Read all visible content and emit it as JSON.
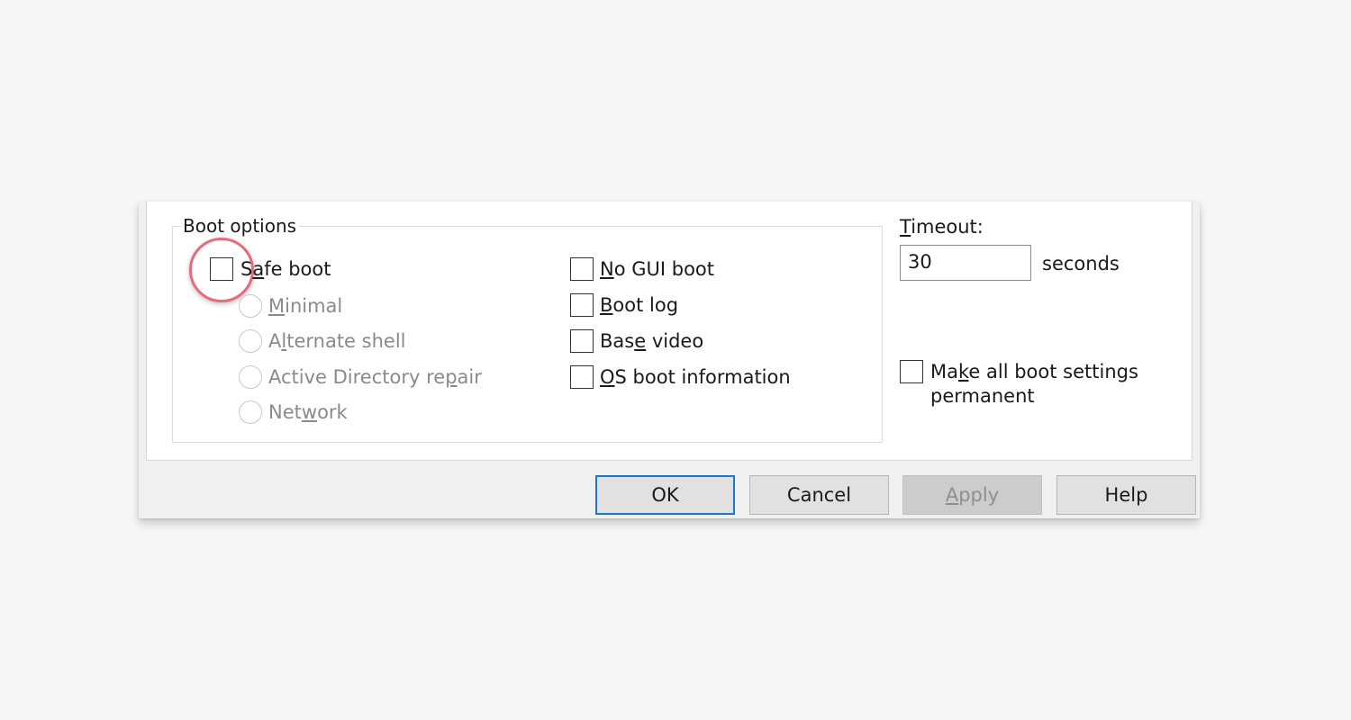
{
  "boot_options": {
    "title": "Boot options",
    "safe_boot": {
      "label_pre": "S",
      "label_mn": "a",
      "label_post": "fe boot",
      "checked": false
    },
    "modes": [
      {
        "pre": "",
        "mn": "M",
        "post": "inimal",
        "enabled": false
      },
      {
        "pre": "A",
        "mn": "l",
        "post": "ternate shell",
        "enabled": false
      },
      {
        "pre": "Active Directory re",
        "mn": "p",
        "post": "air",
        "enabled": false
      },
      {
        "pre": "Net",
        "mn": "w",
        "post": "ork",
        "enabled": false
      }
    ],
    "flags": [
      {
        "pre": "",
        "mn": "N",
        "post": "o GUI boot",
        "checked": false
      },
      {
        "pre": "",
        "mn": "B",
        "post": "oot log",
        "checked": false
      },
      {
        "pre": "Bas",
        "mn": "e",
        "post": " video",
        "checked": false
      },
      {
        "pre": "",
        "mn": "O",
        "post": "S boot information",
        "checked": false
      }
    ]
  },
  "timeout": {
    "label_mn": "T",
    "label_post": "imeout:",
    "value": "30",
    "unit": "seconds"
  },
  "permanent": {
    "pre": "Ma",
    "mn": "k",
    "post": "e all boot settings permanent",
    "checked": false
  },
  "buttons": {
    "ok": "OK",
    "cancel": "Cancel",
    "apply_mn": "A",
    "apply_post": "pply",
    "help": "Help"
  },
  "highlight": {
    "target": "safe-boot-checkbox",
    "color": "#e86a7d"
  }
}
